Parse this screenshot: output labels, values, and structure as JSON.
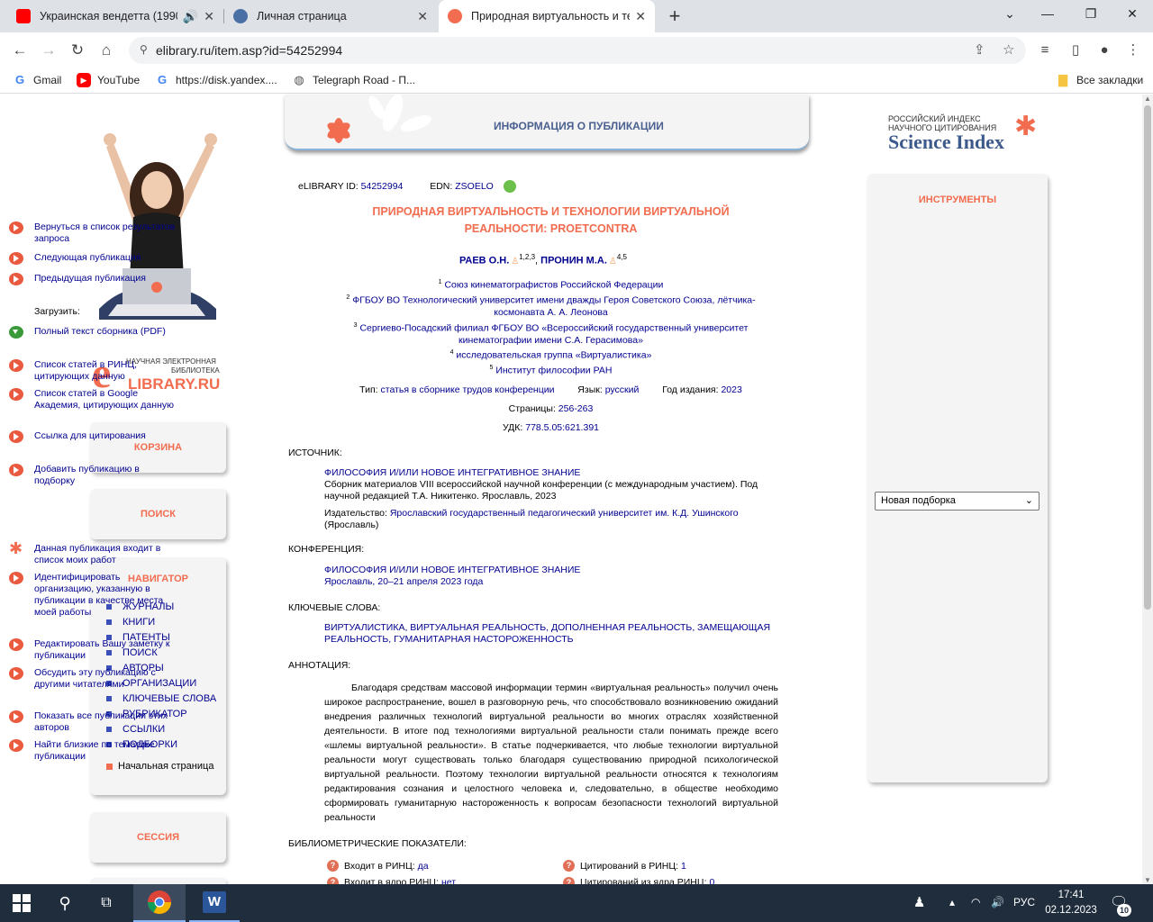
{
  "browser": {
    "tabs": [
      {
        "title": "Украинская вендетта (1990",
        "icon": "youtube-icon",
        "color": "#ff0000",
        "audio": true
      },
      {
        "title": "Личная страница",
        "icon": "globe-icon",
        "color": "#4a6fa5"
      },
      {
        "title": "Природная виртуальность и те",
        "icon": "elibrary-icon",
        "color": "#f26c4f",
        "active": true
      }
    ],
    "url": "elibrary.ru/item.asp?id=54252994",
    "bookmarks": [
      {
        "label": "Gmail",
        "icon": "google-icon"
      },
      {
        "label": "YouTube",
        "icon": "youtube-icon"
      },
      {
        "label": "https://disk.yandex....",
        "icon": "google-icon"
      },
      {
        "label": "Telegraph Road - П...",
        "icon": "globe-icon"
      }
    ],
    "all_bookmarks": "Все закладки"
  },
  "left": {
    "logo_line1": "НАУЧНАЯ ЭЛЕКТРОННАЯ",
    "logo_line2": "БИБЛИОТЕКА",
    "logo_brand": "LIBRARY.RU",
    "logo_e": "e",
    "cart": "КОРЗИНА",
    "search": "ПОИСК",
    "navigator": "НАВИГАТОР",
    "nav_items": [
      "ЖУРНАЛЫ",
      "КНИГИ",
      "ПАТЕНТЫ",
      "ПОИСК",
      "АВТОРЫ",
      "ОРГАНИЗАЦИИ",
      "КЛЮЧЕВЫЕ СЛОВА",
      "РУБРИКАТОР",
      "ССЫЛКИ",
      "ПОДБОРКИ"
    ],
    "home": "Начальная страница",
    "session": "СЕССИЯ"
  },
  "header": {
    "title": "ИНФОРМАЦИЯ О ПУБЛИКАЦИИ"
  },
  "brand": {
    "line1": "РОССИЙСКИЙ ИНДЕКС",
    "line2": "НАУЧНОГО ЦИТИРОВАНИЯ",
    "name": "Science Index"
  },
  "pub": {
    "id_label": "eLIBRARY ID:",
    "id": "54252994",
    "edn_label": "EDN:",
    "edn": "ZSOELO",
    "title_line1": "ПРИРОДНАЯ ВИРТУАЛЬНОСТЬ И ТЕХНОЛОГИИ ВИРТУАЛЬНОЙ",
    "title_line2": "РЕАЛЬНОСТИ: PROETCONTRA",
    "author1": "РАЕВ О.Н.",
    "author1_sup": "1,2,3",
    "author2": "ПРОНИН М.А.",
    "author2_sup": "4,5",
    "affiliations": [
      {
        "n": "1",
        "lines": [
          "Союз кинематографистов Российской Федерации"
        ]
      },
      {
        "n": "2",
        "lines": [
          "ФГБОУ ВО Технологический университет имени дважды Героя Советского Союза, лётчика-",
          "космонавта А. А. Леонова"
        ]
      },
      {
        "n": "3",
        "lines": [
          "Сергиево-Посадский филиал ФГБОУ ВО «Всероссийский государственный университет",
          "кинематографии имени С.А. Герасимова»"
        ]
      },
      {
        "n": "4",
        "lines": [
          "исследовательская группа «Виртуалистика»"
        ]
      },
      {
        "n": "5",
        "lines": [
          "Институт философии РАН"
        ]
      }
    ],
    "type_label": "Тип:",
    "type": "статья в сборнике трудов конференции",
    "lang_label": "Язык:",
    "lang": "русский",
    "year_label": "Год издания:",
    "year": "2023",
    "pages_label": "Страницы:",
    "pages": "256-263",
    "udk_label": "УДК:",
    "udk": "778.5.05:621.391"
  },
  "source": {
    "label": "ИСТОЧНИК:",
    "title": "ФИЛОСОФИЯ И/ИЛИ НОВОЕ ИНТЕГРАТИВНОЕ ЗНАНИЕ",
    "desc_line1": "Сборник материалов VIII всероссийской научной конференции (с международным участием). Под",
    "desc_line2": "научной редакцией Т.А. Никитенко. Ярославль, 2023",
    "publisher_label": "Издательство:",
    "publisher_line1": "Ярославский государственный педагогический университет им. К.Д. Ушинского",
    "publisher_line2": "(Ярославль)"
  },
  "conference": {
    "label": "КОНФЕРЕНЦИЯ:",
    "title": "ФИЛОСОФИЯ И/ИЛИ НОВОЕ ИНТЕГРАТИВНОЕ ЗНАНИЕ",
    "place": "Ярославль, 20–21 апреля 2023 года"
  },
  "keywords": {
    "label": "КЛЮЧЕВЫЕ СЛОВА:",
    "line1": "ВИРТУАЛИСТИКА, ВИРТУАЛЬНАЯ РЕАЛЬНОСТЬ, ДОПОЛНЕННАЯ РЕАЛЬНОСТЬ, ЗАМЕЩАЮЩАЯ",
    "line2": "РЕАЛЬНОСТЬ, ГУМАНИТАРНАЯ НАСТОРОЖЕННОСТЬ"
  },
  "abstract": {
    "label": "АННОТАЦИЯ:",
    "text": "Благодаря средствам массовой информации термин «виртуальная реальность» получил очень широкое распространение, вошел в разговорную речь, что способствовало возникновению ожиданий внедрения различных технологий виртуальной реальности во многих отраслях хозяйственной деятельности. В итоге под технологиями виртуальной реальности стали понимать прежде всего «шлемы виртуальной реальности». В статье подчеркивается, что любые технологии виртуальной реальности могут существовать только благодаря существованию природной психологической виртуальной реальности. Поэтому технологии виртуальной реальности относятся к технологиям редактирования сознания и целостного человека и, следовательно, в обществе необходимо сформировать гуманитарную настороженность к вопросам безопасности технологий виртуальной реальности"
  },
  "bibliometrics": {
    "label": "БИБЛИОМЕТРИЧЕСКИЕ ПОКАЗАТЕЛИ:",
    "in_rinc_label": "Входит в РИНЦ:",
    "in_rinc": "да",
    "in_core_label": "Входит в ядро РИНЦ:",
    "in_core": "нет",
    "cit_rinc_label": "Цитирований в РИНЦ:",
    "cit_rinc": "1",
    "cit_core_label": "Цитирований из ядра РИНЦ:",
    "cit_core": "0"
  },
  "tools": {
    "title": "ИНСТРУМЕНТЫ",
    "back": "Вернуться в список результатов запроса",
    "next": "Следующая публикация",
    "prev": "Предыдущая публикация",
    "download_label": "Загрузить:",
    "fulltext": "Полный текст сборника (PDF)",
    "citing_rinc": "Список статей в РИНЦ, цитирующих данную",
    "citing_google": "Список статей в Google Академия, цитирующих данную",
    "cite_link": "Ссылка для цитирования",
    "add_to": "Добавить публикацию в подборку",
    "select_value": "Новая подборка",
    "in_my_works": "Данная публикация входит в список моих работ",
    "identify_org": "Идентифицировать организацию, указанную в публикации в качестве места моей работы",
    "edit_note": "Редактировать Вашу заметку к публикации",
    "discuss": "Обсудить эту публикацию с другими читателями",
    "all_by_authors": "Показать все публикации этих авторов",
    "similar": "Найти близкие по тематике публикации"
  },
  "taskbar": {
    "lang": "РУС",
    "time": "17:41",
    "date": "02.12.2023",
    "notifications": "10"
  }
}
